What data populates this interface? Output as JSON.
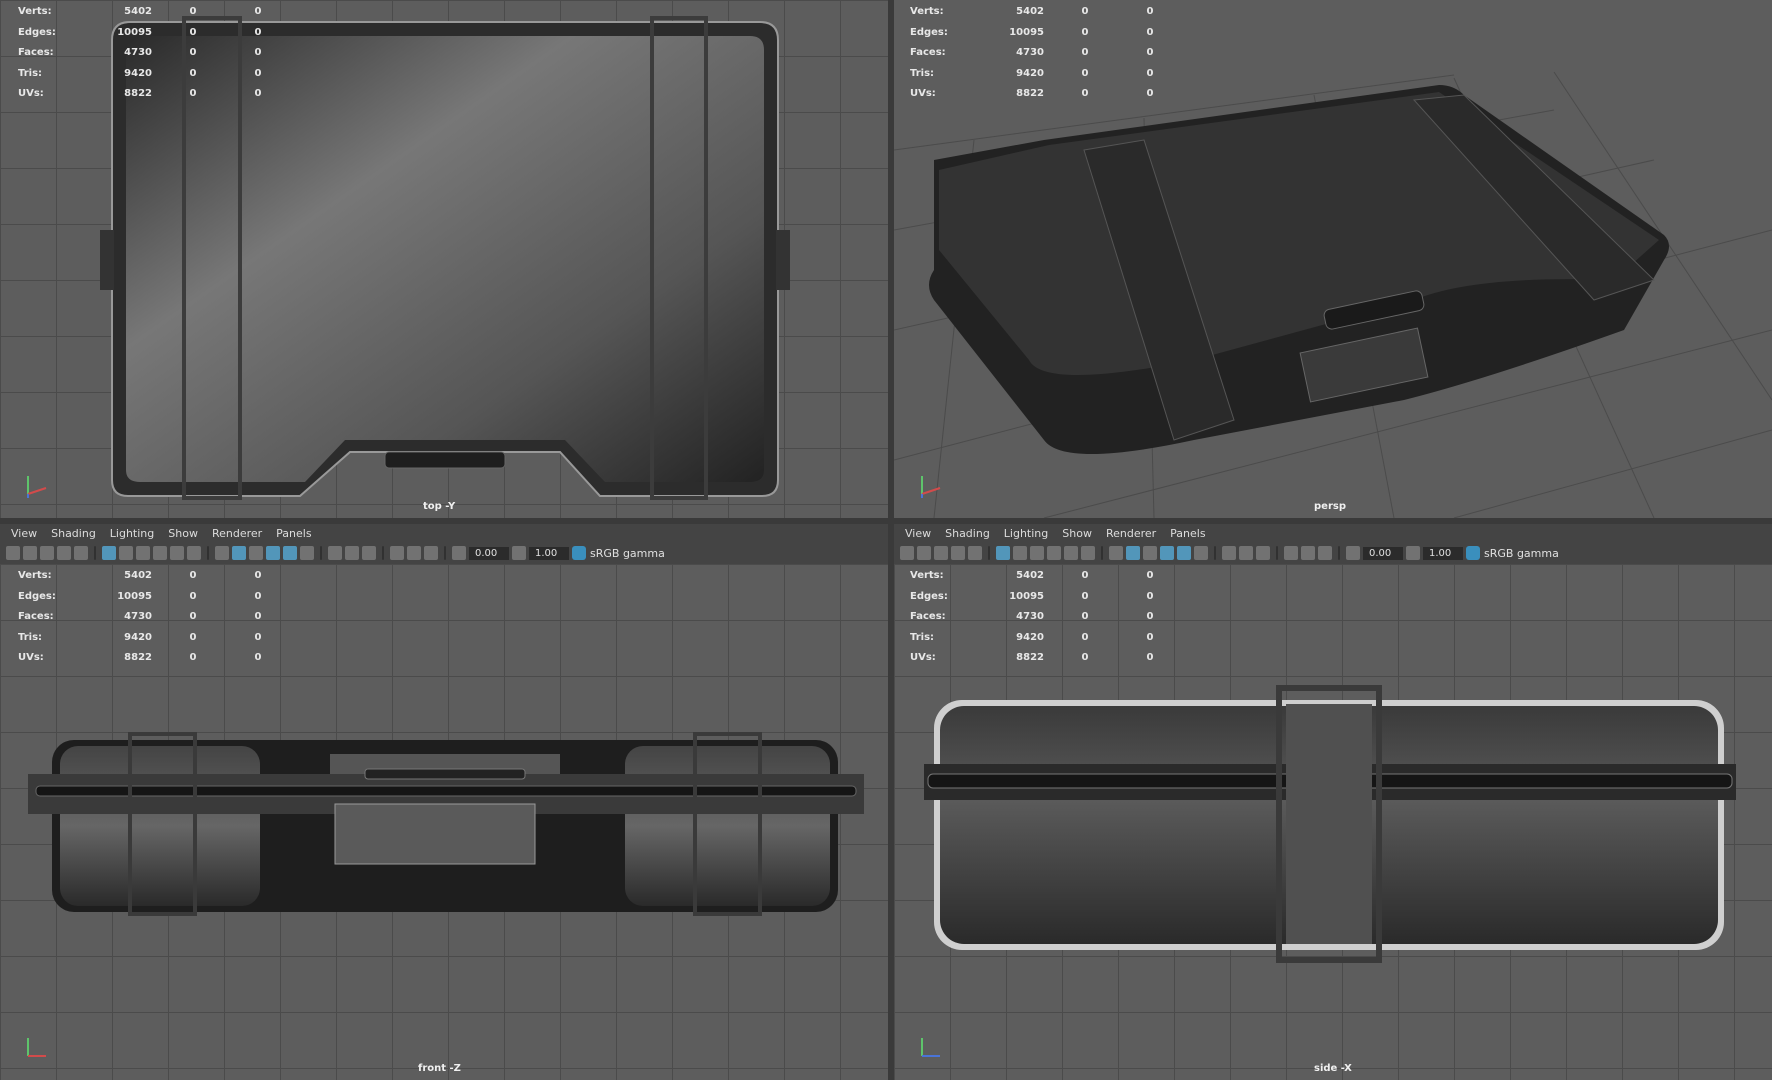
{
  "stats": {
    "labels": [
      "Verts:",
      "Edges:",
      "Faces:",
      "Tris:",
      "UVs:"
    ],
    "values": [
      "5402",
      "10095",
      "4730",
      "9420",
      "8822"
    ],
    "col2": [
      "0",
      "0",
      "0",
      "0",
      "0"
    ],
    "col3": [
      "0",
      "0",
      "0",
      "0",
      "0"
    ]
  },
  "viewports": {
    "top": {
      "camera": "top -Y"
    },
    "persp": {
      "camera": "persp"
    },
    "front": {
      "camera": "front -Z"
    },
    "side": {
      "camera": "side -X"
    }
  },
  "menu": {
    "items": [
      "View",
      "Shading",
      "Lighting",
      "Show",
      "Renderer",
      "Panels"
    ]
  },
  "toolbar": {
    "exposure": "0.00",
    "gamma_value": "1.00",
    "color_space": "sRGB gamma"
  },
  "colors": {
    "viewport_bg": "#5d5d5d",
    "grid_line": "#4b4b4b",
    "menu_bg": "#444444",
    "accent": "#55a5cf"
  }
}
